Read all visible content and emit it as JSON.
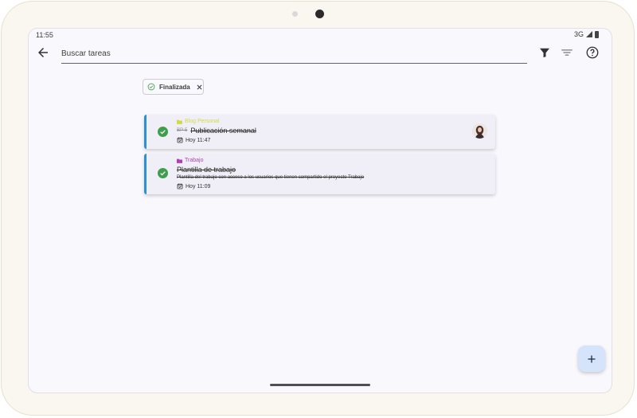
{
  "status_bar": {
    "time": "11:55",
    "network": "3G"
  },
  "search": {
    "placeholder": "Buscar tareas",
    "value": ""
  },
  "filter_chip": {
    "label": "Finalizada"
  },
  "tasks": [
    {
      "project": "Blog Personal",
      "project_color": "#d2db46",
      "prefix": "BP-5",
      "title": "Publicación semanal",
      "description": "",
      "date": "Hoy 11:47",
      "status": "done",
      "has_avatar": true
    },
    {
      "project": "Trabajo",
      "project_color": "#b13fb5",
      "prefix": "",
      "title": "Plantilla de trabajo",
      "description": "Plantilla del trabajo con acceso a los usuarios que tienen compartido el proyecto Trabajo",
      "date": "Hoy 11:09",
      "status": "done",
      "has_avatar": false
    }
  ],
  "colors": {
    "accent": "#2d8fd4",
    "done": "#3d9f4a",
    "fab_bg": "#d5e3fb"
  },
  "icons": [
    "back-arrow-icon",
    "filter-icon",
    "sort-icon",
    "help-icon",
    "check-circle-icon",
    "close-icon",
    "folder-icon",
    "calendar-icon",
    "plus-icon"
  ]
}
